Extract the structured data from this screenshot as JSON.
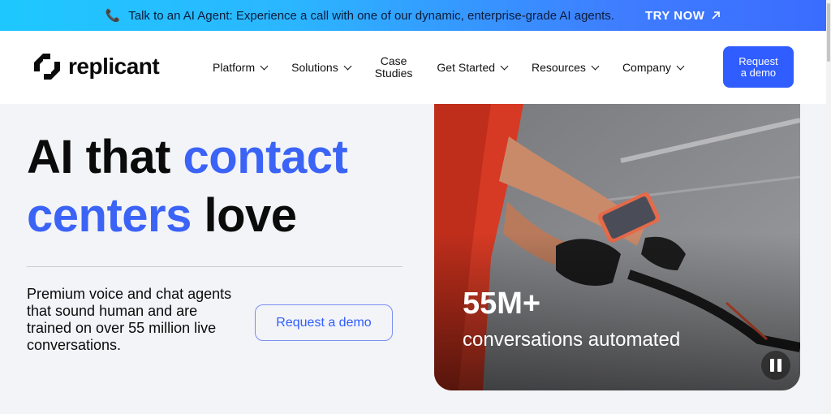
{
  "promo": {
    "message": "Talk to an AI Agent: Experience a call with one of our dynamic, enterprise-grade AI agents.",
    "cta_label": "TRY NOW"
  },
  "header": {
    "logo_text": "replicant",
    "nav": [
      {
        "label": "Platform"
      },
      {
        "label": "Solutions"
      },
      {
        "label_line1": "Case",
        "label_line2": "Studies"
      },
      {
        "label": "Get Started"
      },
      {
        "label": "Resources"
      },
      {
        "label": "Company"
      }
    ],
    "demo_button_line1": "Request",
    "demo_button_line2": "a demo"
  },
  "hero": {
    "headline_part1": "AI that ",
    "headline_accent1": "contact",
    "headline_accent2": "centers",
    "headline_part2": " love",
    "description": "Premium voice and chat agents that sound human and are trained on over 55 million live conversations.",
    "cta_label": "Request a demo",
    "stat_value": "55M+",
    "stat_label": "conversations automated"
  },
  "colors": {
    "accent": "#3b63f6",
    "button_primary": "#2f5dff",
    "hero_background": "#f3f4f8"
  }
}
